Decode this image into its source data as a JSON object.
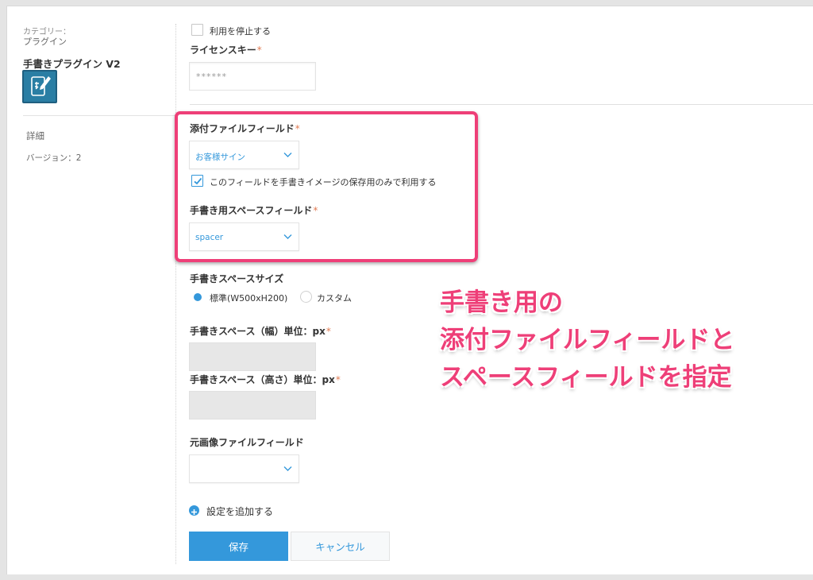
{
  "sidebar": {
    "category_label": "カテゴリー：",
    "category_value": "プラグイン",
    "plugin_name": "手書きプラグイン V2",
    "plugin_icon": "handwriting-plugin-icon",
    "detail_label": "詳細",
    "version_label": "バージョン：",
    "version_value": "2"
  },
  "form": {
    "stop_usage_label": "利用を停止する",
    "stop_usage_checked": false,
    "license_key_label": "ライセンスキー",
    "license_key_value": "******",
    "required_mark": "*",
    "attachment_field_label": "添付ファイルフィールド",
    "attachment_field_value": "お客様サイン",
    "use_only_for_image_label": "このフィールドを手書きイメージの保存用のみで利用する",
    "use_only_for_image_checked": true,
    "space_field_label": "手書き用スペースフィールド",
    "space_field_value": "spacer",
    "space_size_label": "手書きスペースサイズ",
    "size_option_standard": "標準(W500xH200)",
    "size_option_custom": "カスタム",
    "size_selected": "standard",
    "width_label": "手書きスペース（幅）単位：px",
    "height_label": "手書きスペース（高さ）単位：px",
    "original_image_field_label": "元画像ファイルフィールド",
    "original_image_field_value": "",
    "add_setting_label": "設定を追加する",
    "save_label": "保存",
    "cancel_label": "キャンセル"
  },
  "annotation": {
    "line1": "手書き用の",
    "line2": "添付ファイルフィールドと",
    "line3": "スペースフィールドを指定"
  },
  "colors": {
    "accent": "#3498db",
    "highlight": "#ee3f78",
    "required": "#e07b53"
  }
}
